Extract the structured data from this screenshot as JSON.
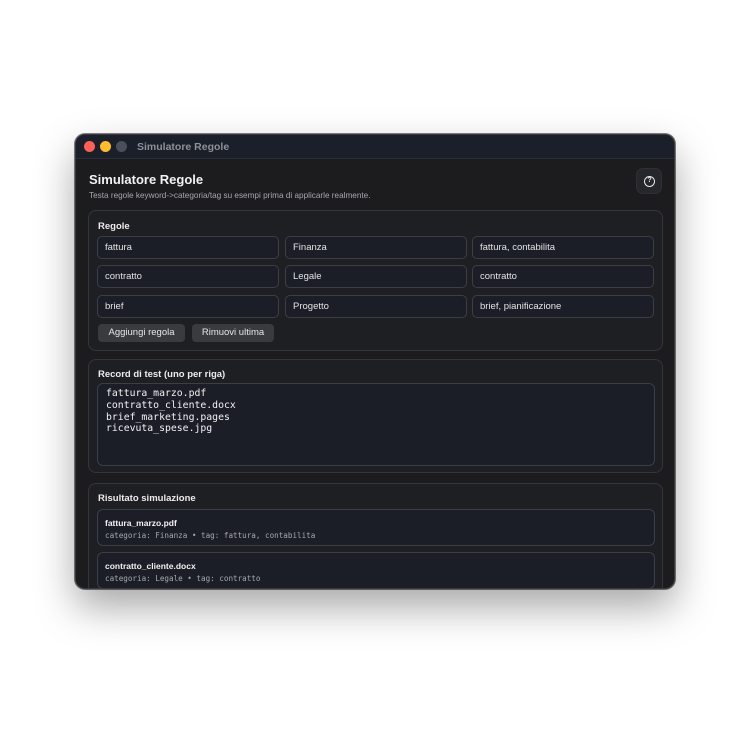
{
  "window": {
    "title": "Simulatore Regole"
  },
  "header": {
    "title": "Simulatore Regole",
    "subtitle": "Testa regole keyword->categoria/tag su esempi prima di applicarle realmente.",
    "help_icon": "question-circle-icon"
  },
  "rules": {
    "title": "Regole",
    "rows": [
      {
        "keyword": "fattura",
        "category": "Finanza",
        "tags": "fattura, contabilita"
      },
      {
        "keyword": "contratto",
        "category": "Legale",
        "tags": "contratto"
      },
      {
        "keyword": "brief",
        "category": "Progetto",
        "tags": "brief, pianificazione"
      }
    ],
    "add_label": "Aggiungi regola",
    "remove_label": "Rimuovi ultima"
  },
  "records": {
    "title": "Record di test (uno per riga)",
    "lines": [
      "fattura_marzo.pdf",
      "contratto_cliente.docx",
      "brief_marketing.pages",
      "ricevuta_spese.jpg"
    ]
  },
  "results": {
    "title": "Risultato simulazione",
    "items": [
      {
        "name": "fattura_marzo.pdf",
        "detail": "categoria: Finanza • tag: fattura, contabilita"
      },
      {
        "name": "contratto_cliente.docx",
        "detail": "categoria: Legale • tag: contratto"
      }
    ]
  },
  "colors": {
    "window_bg": "#1c1c1e",
    "panel_bg": "#1e1f23",
    "field_bg": "#1b1e26",
    "close": "#fe5f57",
    "minimize": "#febc2e"
  }
}
